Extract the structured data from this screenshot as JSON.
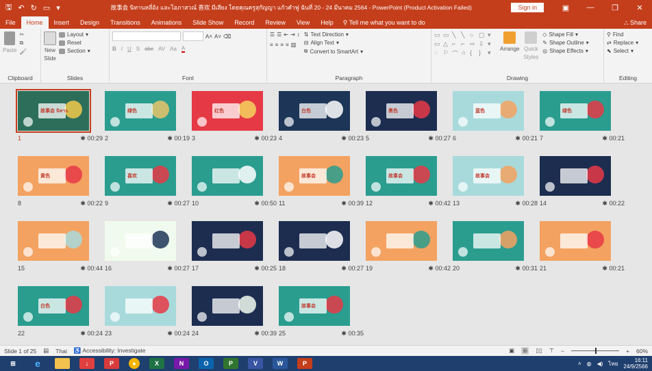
{
  "app": {
    "title": "故事会 นิทานหลี่อ้ง และโอภาสวณ์ 喜欢 มีเสียง โดยคุณครูสุกัญญา แก้วคำฟู ฉันที่ 20 - 24 มีนาคม 2564  -  PowerPoint (Product Activation Failed)",
    "signin": "Sign in",
    "accent": "#c43e1c"
  },
  "tabs": [
    "File",
    "Home",
    "Insert",
    "Design",
    "Transitions",
    "Animations",
    "Slide Show",
    "Record",
    "Review",
    "View",
    "Help"
  ],
  "active_tab": "Home",
  "tellme": "Tell me what you want to do",
  "share": "Share",
  "ribbon": {
    "clipboard": {
      "label": "Clipboard",
      "paste": "Paste"
    },
    "slides": {
      "label": "Slides",
      "new_slide": "New",
      "new_slide2": "Slide",
      "layout": "Layout",
      "reset": "Reset",
      "section": "Section"
    },
    "font": {
      "label": "Font",
      "bold": "B",
      "italic": "I",
      "underline": "U",
      "strike": "S",
      "abc": "abc",
      "av": "AV",
      "aa": "Aa",
      "a": "A"
    },
    "paragraph": {
      "label": "Paragraph",
      "text_direction": "Text Direction",
      "align_text": "Align Text",
      "convert_smartart": "Convert to SmartArt"
    },
    "drawing": {
      "label": "Drawing",
      "arrange": "Arrange",
      "quick": "Quick",
      "styles": "Styles",
      "shape_fill": "Shape Fill",
      "shape_outline": "Shape Outline",
      "shape_effects": "Shape Effects"
    },
    "editing": {
      "label": "Editing",
      "find": "Find",
      "replace": "Replace",
      "select": "Select"
    }
  },
  "slides": [
    {
      "num": "1",
      "dur": "00:29",
      "bg": "#2c6e5a",
      "accent": "#f2c94c",
      "label": "故事会 นิทานหลี่อ้ง"
    },
    {
      "num": "2",
      "dur": "00:19",
      "bg": "#2a9d8f",
      "accent": "#e9c46a",
      "label": "绿色"
    },
    {
      "num": "3",
      "dur": "00:23",
      "bg": "#e63946",
      "accent": "#f4d35e",
      "label": "红色"
    },
    {
      "num": "4",
      "dur": "00:23",
      "bg": "#1d3557",
      "accent": "#ffffff",
      "label": "白色"
    },
    {
      "num": "5",
      "dur": "00:27",
      "bg": "#1d2d50",
      "accent": "#e63946",
      "label": "黑色"
    },
    {
      "num": "6",
      "dur": "00:21",
      "bg": "#a8dadc",
      "accent": "#f4a261",
      "label": "蓝色"
    },
    {
      "num": "7",
      "dur": "00:21",
      "bg": "#2a9d8f",
      "accent": "#e63946",
      "label": "绿色"
    },
    {
      "num": "8",
      "dur": "00:22",
      "bg": "#f4a261",
      "accent": "#e63946",
      "label": "黄色"
    },
    {
      "num": "9",
      "dur": "00:27",
      "bg": "#2a9d8f",
      "accent": "#e63946",
      "label": "喜欢"
    },
    {
      "num": "10",
      "dur": "00:50",
      "bg": "#2a9d8f",
      "accent": "#ffffff",
      "label": ""
    },
    {
      "num": "11",
      "dur": "00:39",
      "bg": "#f4a261",
      "accent": "#2a9d8f",
      "label": "故事会"
    },
    {
      "num": "12",
      "dur": "00:42",
      "bg": "#2a9d8f",
      "accent": "#e63946",
      "label": "故事会"
    },
    {
      "num": "13",
      "dur": "00:28",
      "bg": "#a8dadc",
      "accent": "#f4a261",
      "label": "故事会"
    },
    {
      "num": "14",
      "dur": "00:22",
      "bg": "#1d2d50",
      "accent": "#e63946",
      "label": ""
    },
    {
      "num": "15",
      "dur": "00:44",
      "bg": "#f4a261",
      "accent": "#a8dadc",
      "label": ""
    },
    {
      "num": "16",
      "dur": "00:27",
      "bg": "#f1faee",
      "accent": "#1d3557",
      "label": ""
    },
    {
      "num": "17",
      "dur": "00:25",
      "bg": "#1d2d50",
      "accent": "#e63946",
      "label": ""
    },
    {
      "num": "18",
      "dur": "00:27",
      "bg": "#1d2d50",
      "accent": "#ffffff",
      "label": ""
    },
    {
      "num": "19",
      "dur": "00:42",
      "bg": "#f4a261",
      "accent": "#2a9d8f",
      "label": ""
    },
    {
      "num": "20",
      "dur": "00:31",
      "bg": "#2a9d8f",
      "accent": "#f4a261",
      "label": ""
    },
    {
      "num": "21",
      "dur": "00:21",
      "bg": "#f4a261",
      "accent": "#e63946",
      "label": ""
    },
    {
      "num": "22",
      "dur": "00:24",
      "bg": "#2a9d8f",
      "accent": "#e63946",
      "label": "白色"
    },
    {
      "num": "23",
      "dur": "00:24",
      "bg": "#a8dadc",
      "accent": "#e63946",
      "label": ""
    },
    {
      "num": "24",
      "dur": "00:39",
      "bg": "#1d2d50",
      "accent": "#f1faee",
      "label": ""
    },
    {
      "num": "25",
      "dur": "00:35",
      "bg": "#2a9d8f",
      "accent": "#e63946",
      "label": "故事会"
    }
  ],
  "status": {
    "slide_of": "Slide 1 of 25",
    "language": "Thai",
    "accessibility": "Accessibility: Investigate",
    "zoom": "60%"
  },
  "taskbar": {
    "time": "16:11",
    "date": "24/9/2566",
    "lang": "ไทย"
  }
}
